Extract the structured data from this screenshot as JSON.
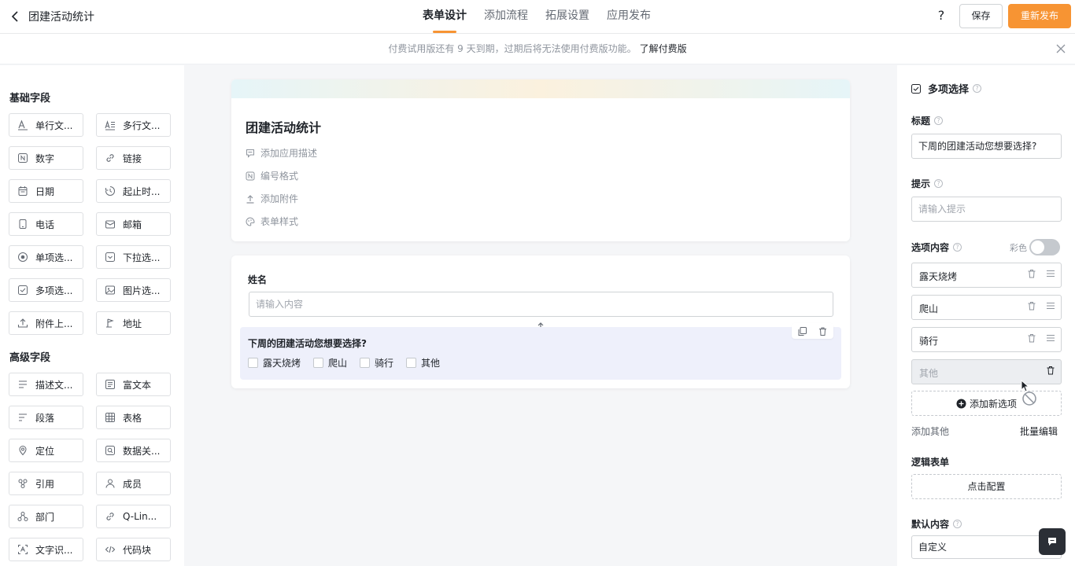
{
  "header": {
    "title": "团建活动统计",
    "tabs": [
      "表单设计",
      "添加流程",
      "拓展设置",
      "应用发布"
    ],
    "active_tab": 0,
    "help": "?",
    "save": "保存",
    "publish": "重新发布"
  },
  "notice": {
    "text": "付费试用版还有 9 天到期，过期后将无法使用付费版功能。",
    "link": "了解付费版"
  },
  "left": {
    "basic_title": "基础字段",
    "basic": [
      {
        "label": "单行文...",
        "icon": "text-a-icon"
      },
      {
        "label": "多行文...",
        "icon": "multiline-text-icon"
      },
      {
        "label": "数字",
        "icon": "number-icon"
      },
      {
        "label": "链接",
        "icon": "link-icon"
      },
      {
        "label": "日期",
        "icon": "calendar-icon"
      },
      {
        "label": "起止时...",
        "icon": "time-range-icon"
      },
      {
        "label": "电话",
        "icon": "phone-icon"
      },
      {
        "label": "邮箱",
        "icon": "mail-icon"
      },
      {
        "label": "单项选...",
        "icon": "radio-icon"
      },
      {
        "label": "下拉选...",
        "icon": "dropdown-icon"
      },
      {
        "label": "多项选...",
        "icon": "checkbox-icon"
      },
      {
        "label": "图片选...",
        "icon": "image-icon"
      },
      {
        "label": "附件上...",
        "icon": "upload-icon"
      },
      {
        "label": "地址",
        "icon": "address-icon"
      }
    ],
    "advanced_title": "高级字段",
    "advanced": [
      {
        "label": "描述文...",
        "icon": "description-icon"
      },
      {
        "label": "富文本",
        "icon": "rich-text-icon"
      },
      {
        "label": "段落",
        "icon": "paragraph-icon"
      },
      {
        "label": "表格",
        "icon": "table-icon"
      },
      {
        "label": "定位",
        "icon": "location-icon"
      },
      {
        "label": "数据关...",
        "icon": "data-link-icon"
      },
      {
        "label": "引用",
        "icon": "reference-icon"
      },
      {
        "label": "成员",
        "icon": "member-icon"
      },
      {
        "label": "部门",
        "icon": "department-icon"
      },
      {
        "label": "Q-Lin...",
        "icon": "q-link-icon"
      },
      {
        "label": "文字识...",
        "icon": "ocr-icon"
      },
      {
        "label": "代码块",
        "icon": "code-icon"
      }
    ]
  },
  "form": {
    "title": "团建活动统计",
    "meta": [
      {
        "label": "添加应用描述",
        "icon": "comment-icon"
      },
      {
        "label": "编号格式",
        "icon": "number-format-icon"
      },
      {
        "label": "添加附件",
        "icon": "attachment-upload-icon"
      },
      {
        "label": "表单样式",
        "icon": "palette-icon"
      }
    ],
    "name_label": "姓名",
    "name_placeholder": "请输入内容",
    "question": "下周的团建活动您想要选择?",
    "options": [
      "露天烧烤",
      "爬山",
      "骑行",
      "其他"
    ]
  },
  "right": {
    "type": "多项选择",
    "title_label": "标题",
    "title_value": "下周的团建活动您想要选择?",
    "hint_label": "提示",
    "hint_placeholder": "请输入提示",
    "options_label": "选项内容",
    "color_label": "彩色",
    "color_on": false,
    "options": [
      "露天烧烤",
      "爬山",
      "骑行"
    ],
    "other_placeholder": "其他",
    "add_option": "添加新选项",
    "add_other": "添加其他",
    "batch_edit": "批量编辑",
    "logic_label": "逻辑表单",
    "logic_button": "点击配置",
    "default_label": "默认内容",
    "default_value": "自定义"
  }
}
